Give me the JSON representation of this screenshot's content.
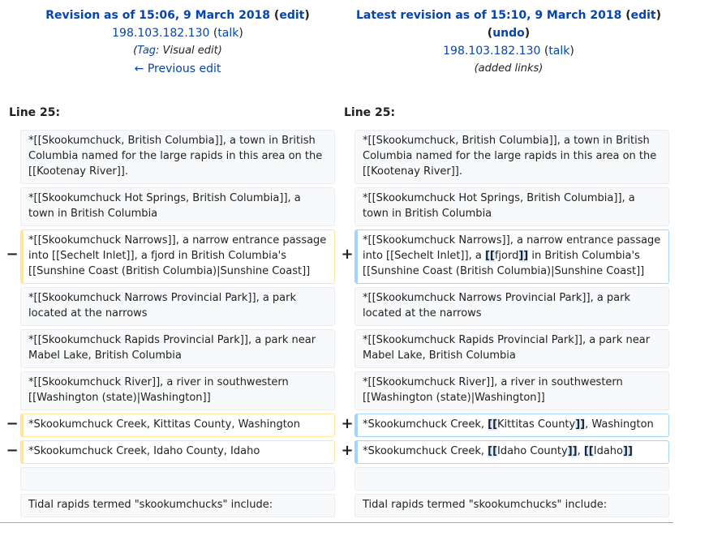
{
  "left_header": {
    "title": "Revision as of 15:06, 9 March 2018",
    "edit_label": "edit",
    "user": "198.103.182.130",
    "talk_label": "talk",
    "tag_prefix": "(",
    "tag_link": "Tag",
    "tag_rest": ": Visual edit)",
    "prev_label": "← Previous edit"
  },
  "right_header": {
    "title": "Latest revision as of 15:10, 9 March 2018",
    "edit_label": "edit",
    "undo_label": "undo",
    "user": "198.103.182.130",
    "talk_label": "talk",
    "summary": "(added links)"
  },
  "line_number_left": "Line 25:",
  "line_number_right": "Line 25:",
  "markers": {
    "minus": "−",
    "plus": "+"
  },
  "rows": [
    {
      "left": "*[[Skookumchuck, British Columbia]], a town in British Columbia named for the large rapids in this area on the [[Kootenay River]].",
      "right": "*[[Skookumchuck, British Columbia]], a town in British Columbia named for the large rapids in this area on the [[Kootenay River]]."
    },
    {
      "left": "*[[Skookumchuck Hot Springs, British Columbia]], a town in British Columbia",
      "right": "*[[Skookumchuck Hot Springs, British Columbia]], a town in British Columbia"
    },
    {
      "left": "*[[Skookumchuck Narrows]], a narrow entrance passage into [[Sechelt Inlet]], a fjord in British Columbia's [[Sunshine Coast (British Columbia)|Sunshine Coast]]",
      "right_parts": [
        "*[[Skookumchuck Narrows]], a narrow entrance passage into [[Sechelt Inlet]], a ",
        "[[",
        "fjord",
        "]]",
        " in British Columbia's [[Sunshine Coast (British Columbia)|Sunshine Coast]]"
      ]
    },
    {
      "left": "*[[Skookumchuck Narrows Provincial Park]], a park located at the narrows",
      "right": "*[[Skookumchuck Narrows Provincial Park]], a park located at the narrows"
    },
    {
      "left": "*[[Skookumchuck Rapids Provincial Park]], a park near Mabel Lake, British Columbia",
      "right": "*[[Skookumchuck Rapids Provincial Park]], a park near Mabel Lake, British Columbia"
    },
    {
      "left": "*[[Skookumchuck River]], a river in southwestern [[Washington (state)|Washington]]",
      "right": "*[[Skookumchuck River]], a river in southwestern [[Washington (state)|Washington]]"
    },
    {
      "left": "*Skookumchuck Creek, Kittitas County, Washington",
      "right_parts": [
        "*Skookumchuck Creek, ",
        "[[",
        "Kittitas County",
        "]]",
        ", Washington"
      ]
    },
    {
      "left": "*Skookumchuck Creek, Idaho County, Idaho",
      "right_parts": [
        "*Skookumchuck Creek, ",
        "[[",
        "Idaho County",
        "]]",
        ", ",
        "[[",
        "Idaho",
        "]]"
      ]
    },
    {
      "left": "",
      "right": ""
    },
    {
      "left": "Tidal rapids termed \"skookumchucks\" include:",
      "right": "Tidal rapids termed \"skookumchucks\" include:"
    }
  ]
}
